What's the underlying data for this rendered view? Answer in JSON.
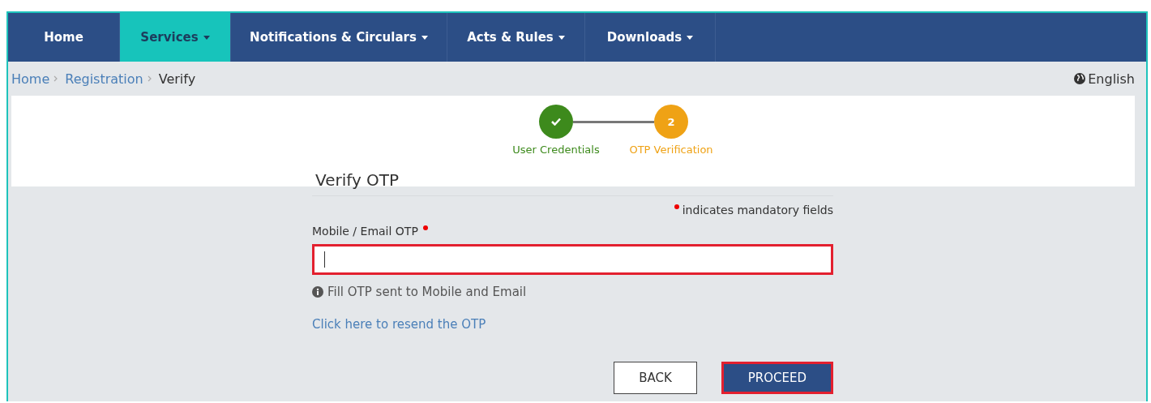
{
  "nav": {
    "items": [
      {
        "label": "Home",
        "selected": false,
        "dropdown": false
      },
      {
        "label": "Services",
        "selected": true,
        "dropdown": true
      },
      {
        "label": "Notifications & Circulars",
        "selected": false,
        "dropdown": true
      },
      {
        "label": "Acts & Rules",
        "selected": false,
        "dropdown": true
      },
      {
        "label": "Downloads",
        "selected": false,
        "dropdown": true
      }
    ]
  },
  "breadcrumb": [
    {
      "label": "Home",
      "link": true
    },
    {
      "label": "Registration",
      "link": true
    },
    {
      "label": "Verify",
      "link": false
    }
  ],
  "language": "English",
  "stepper": [
    {
      "label": "User Credentials",
      "done": true
    },
    {
      "label": "OTP Verification",
      "done": false,
      "number": "2"
    }
  ],
  "form": {
    "title": "Verify OTP",
    "mandatory_note": "indicates mandatory fields",
    "field_label": "Mobile / Email OTP",
    "field_required": true,
    "field_highlighted": true,
    "help": "Fill OTP sent to Mobile and Email",
    "resend_link": "Click here to resend the OTP"
  },
  "buttons": [
    {
      "label": "BACK",
      "kind": "secondary",
      "highlighted": false
    },
    {
      "label": "PROCEED",
      "kind": "primary",
      "highlighted": true
    }
  ]
}
